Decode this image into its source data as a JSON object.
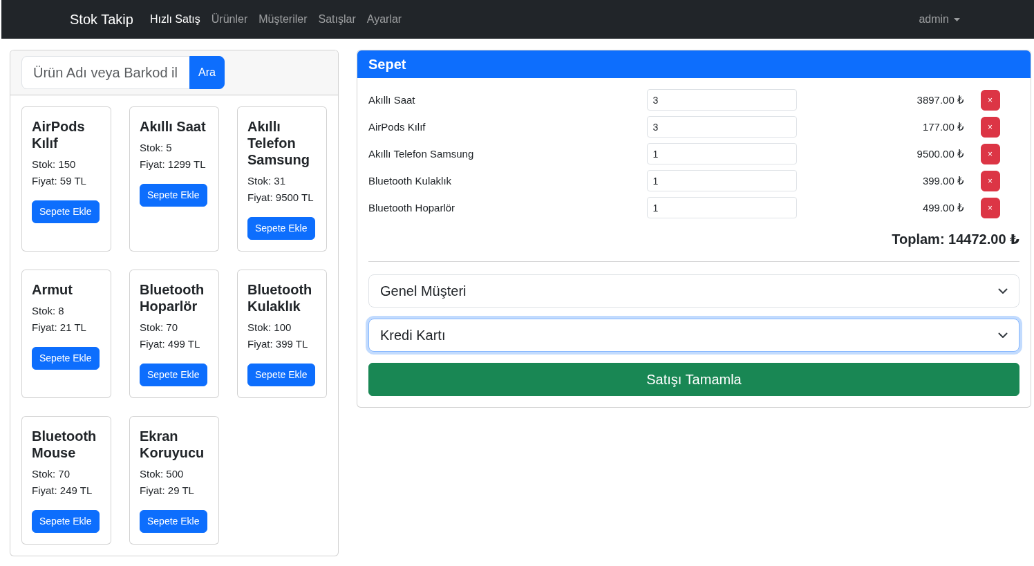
{
  "navbar": {
    "brand": "Stok Takip",
    "links": [
      {
        "label": "Hızlı Satış",
        "selected": true
      },
      {
        "label": "Ürünler",
        "selected": false
      },
      {
        "label": "Müşteriler",
        "selected": false
      },
      {
        "label": "Satışlar",
        "selected": false
      },
      {
        "label": "Ayarlar",
        "selected": false
      }
    ],
    "user_menu": {
      "label": "admin"
    }
  },
  "search": {
    "placeholder": "Ürün Adı veya Barkod il",
    "button": "Ara"
  },
  "products": [
    {
      "name": "AirPods Kılıf",
      "stock": "Stok: 150",
      "price": "Fiyat: 59 TL",
      "button": "Sepete Ekle"
    },
    {
      "name": "Akıllı Saat",
      "stock": "Stok: 5",
      "price": "Fiyat: 1299 TL",
      "button": "Sepete Ekle"
    },
    {
      "name": "Akıllı Telefon Samsung",
      "stock": "Stok: 31",
      "price": "Fiyat: 9500 TL",
      "button": "Sepete Ekle"
    },
    {
      "name": "Armut",
      "stock": "Stok: 8",
      "price": "Fiyat: 21 TL",
      "button": "Sepete Ekle"
    },
    {
      "name": "Bluetooth Hoparlör",
      "stock": "Stok: 70",
      "price": "Fiyat: 499 TL",
      "button": "Sepete Ekle"
    },
    {
      "name": "Bluetooth Kulaklık",
      "stock": "Stok: 100",
      "price": "Fiyat: 399 TL",
      "button": "Sepete Ekle"
    },
    {
      "name": "Bluetooth Mouse",
      "stock": "Stok: 70",
      "price": "Fiyat: 249 TL",
      "button": "Sepete Ekle"
    },
    {
      "name": "Ekran Koruyucu",
      "stock": "Stok: 500",
      "price": "Fiyat: 29 TL",
      "button": "Sepete Ekle"
    }
  ],
  "cart": {
    "title": "Sepet",
    "items": [
      {
        "name": "Akıllı Saat",
        "quantity": "3",
        "total": "3897.00 ₺",
        "remove": "×"
      },
      {
        "name": "AirPods Kılıf",
        "quantity": "3",
        "total": "177.00 ₺",
        "remove": "×"
      },
      {
        "name": "Akıllı Telefon Samsung",
        "quantity": "1",
        "total": "9500.00 ₺",
        "remove": "×"
      },
      {
        "name": "Bluetooth Kulaklık",
        "quantity": "1",
        "total": "399.00 ₺",
        "remove": "×"
      },
      {
        "name": "Bluetooth Hoparlör",
        "quantity": "1",
        "total": "499.00 ₺",
        "remove": "×"
      }
    ],
    "total": "Toplam: 14472.00 ₺",
    "customer_select": {
      "value": "Genel Müşteri",
      "focused": false
    },
    "payment_select": {
      "value": "Kredi Kartı",
      "focused": true
    },
    "submit": "Satışı Tamamla"
  }
}
